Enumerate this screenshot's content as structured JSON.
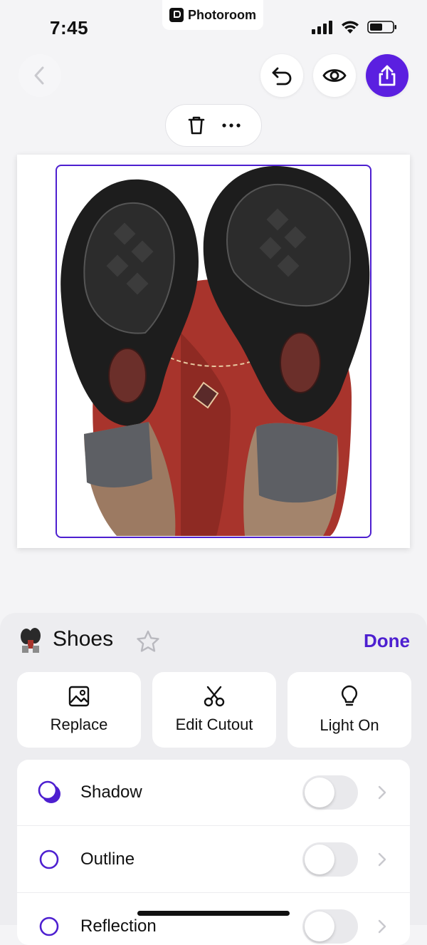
{
  "status_bar": {
    "time": "7:45",
    "app_name": "Photoroom",
    "icons": [
      "signal-icon",
      "wifi-icon",
      "battery-icon"
    ]
  },
  "toolbar": {
    "icons": [
      "back-icon",
      "undo-icon",
      "eye-icon",
      "share-icon"
    ],
    "accent": "#5b1fe0"
  },
  "object_actions": {
    "icons": [
      "trash-icon",
      "more-icon"
    ]
  },
  "canvas": {
    "image": "boot-soles-photo",
    "selection_color": "#4d1fd0"
  },
  "sheet": {
    "title": "Shoes",
    "done_label": "Done",
    "actions": [
      {
        "label": "Replace",
        "icon": "image-icon"
      },
      {
        "label": "Edit Cutout",
        "icon": "scissors-icon"
      },
      {
        "label": "Light On",
        "icon": "lightbulb-icon"
      }
    ],
    "options": [
      {
        "label": "Shadow",
        "on": false
      },
      {
        "label": "Outline",
        "on": false
      },
      {
        "label": "Reflection",
        "on": false
      }
    ]
  }
}
